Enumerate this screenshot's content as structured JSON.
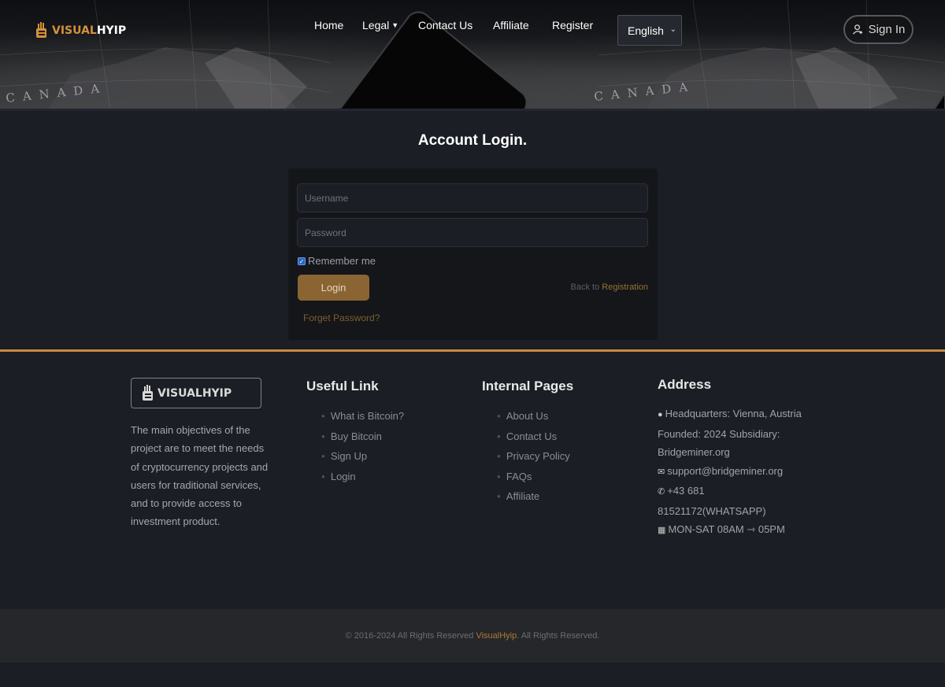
{
  "brand": {
    "part1": "VISUAL",
    "part2": "HYIP"
  },
  "nav": {
    "home": "Home",
    "legal": "Legal",
    "contact": "Contact Us",
    "affiliate": "Affiliate",
    "register": "Register",
    "language": "English",
    "signin": "Sign In"
  },
  "login": {
    "title": "Account Login.",
    "username_placeholder": "Username",
    "password_placeholder": "Password",
    "remember": "Remember me",
    "remember_checked": true,
    "button": "Login",
    "back_text": "Back to",
    "back_link": "Registration",
    "forgot": "Forget Password?"
  },
  "footer": {
    "description": "The main objectives of the project are to meet the needs of cryptocurrency projects and users for traditional services, and to provide access to investment product.",
    "useful_title": "Useful Link",
    "useful_links": [
      "What is Bitcoin?",
      "Buy Bitcoin",
      "Sign Up",
      "Login"
    ],
    "internal_title": "Internal Pages",
    "internal_links": [
      "About Us",
      "Contact Us",
      "Privacy Policy",
      "FAQs",
      "Affiliate"
    ],
    "address_title": "Address",
    "address_hq": "Headquarters: Vienna, Austria Founded: 2024 Subsidiary: Bridgeminer.org",
    "email": "support@bridgeminer.org",
    "phone": "+43 681 81521172(WHATSAPP)",
    "hours": "MON-SAT 08AM ⇾ 05PM"
  },
  "copyright": {
    "prefix": "© 2016-2024 All Rights Reserved",
    "brand": "VisualHyip",
    "suffix": ". All Rights Reserved."
  },
  "colors": {
    "accent": "#c58a3e",
    "button": "#8a6533",
    "background": "#1b1e24"
  },
  "map_labels": [
    "CANADA",
    "CANADA"
  ]
}
